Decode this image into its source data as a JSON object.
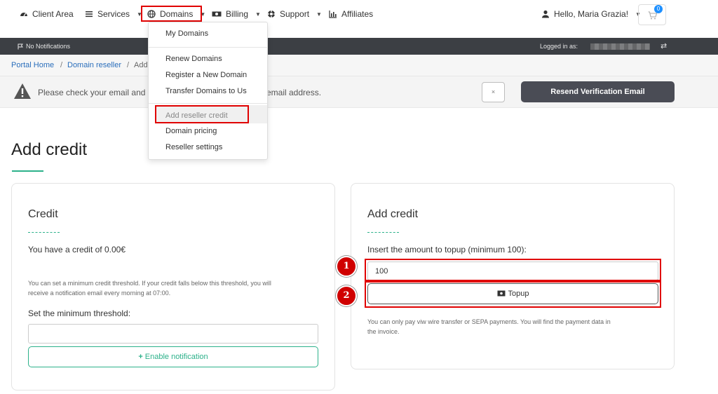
{
  "nav": {
    "client_area": "Client Area",
    "services": "Services",
    "domains": "Domains",
    "billing": "Billing",
    "support": "Support",
    "affiliates": "Affiliates",
    "user": "Hello, Maria Grazia!",
    "cart_count": "0"
  },
  "statusbar": {
    "notifications": "No Notifications",
    "logged_in_as": "Logged in as:"
  },
  "breadcrumb": {
    "home": "Portal Home",
    "reseller": "Domain reseller",
    "current": "Add"
  },
  "alert": {
    "text_start": "Please check your email and",
    "text_end": "email address.",
    "dismiss": "×",
    "resend": "Resend Verification Email"
  },
  "dropdown": {
    "my_domains": "My Domains",
    "renew": "Renew Domains",
    "register": "Register a New Domain",
    "transfer": "Transfer Domains to Us",
    "add_credit": "Add reseller credit",
    "pricing": "Domain pricing",
    "settings": "Reseller settings"
  },
  "page": {
    "title": "Add credit"
  },
  "credit_card": {
    "title": "Credit",
    "balance": "You have a credit of 0.00€",
    "info_line1": "You can set a minimum credit threshold. If your credit falls below this threshold, you will",
    "info_line2": "receive a notification email every morning at 07:00.",
    "threshold_label": "Set the minimum threshold:",
    "threshold_value": "",
    "enable_button": "Enable notification"
  },
  "add_credit_card": {
    "title": "Add credit",
    "amount_label": "Insert the amount to topup (minimum 100):",
    "amount_value": "100",
    "topup_button": "Topup",
    "note_line1": "You can only pay viw wire transfer or SEPA payments. You will find the payment data in",
    "note_line2": "the invoice."
  },
  "annotations": {
    "step1": "1",
    "step2": "2"
  },
  "colors": {
    "accent_green": "#2cb18a",
    "highlight_red": "#e00000",
    "dark_bar": "#3c3f44",
    "button_dark": "#4a4c55",
    "link_blue": "#2a6ebb"
  }
}
